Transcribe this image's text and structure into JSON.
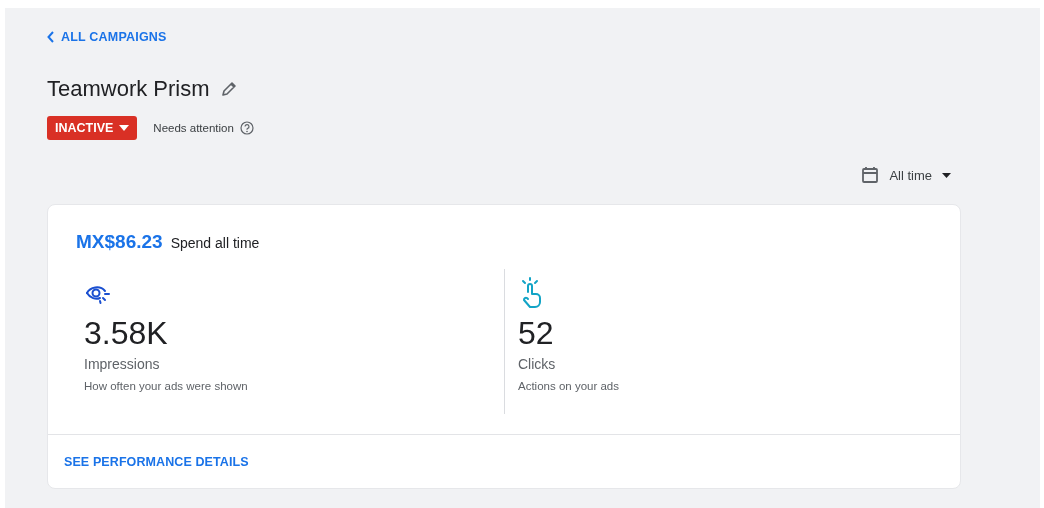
{
  "back_link": "ALL CAMPAIGNS",
  "campaign": {
    "title": "Teamwork Prism",
    "status": "INACTIVE",
    "status_note": "Needs attention"
  },
  "date_range": {
    "label": "All time"
  },
  "summary": {
    "amount": "MX$86.23",
    "label": "Spend all time",
    "metrics": [
      {
        "kind": "eye",
        "value": "3.58K",
        "label": "Impressions",
        "description": "How often your ads were shown"
      },
      {
        "kind": "tap",
        "value": "52",
        "label": "Clicks",
        "description": "Actions on your ads"
      }
    ],
    "footer_link": "SEE PERFORMANCE DETAILS"
  }
}
